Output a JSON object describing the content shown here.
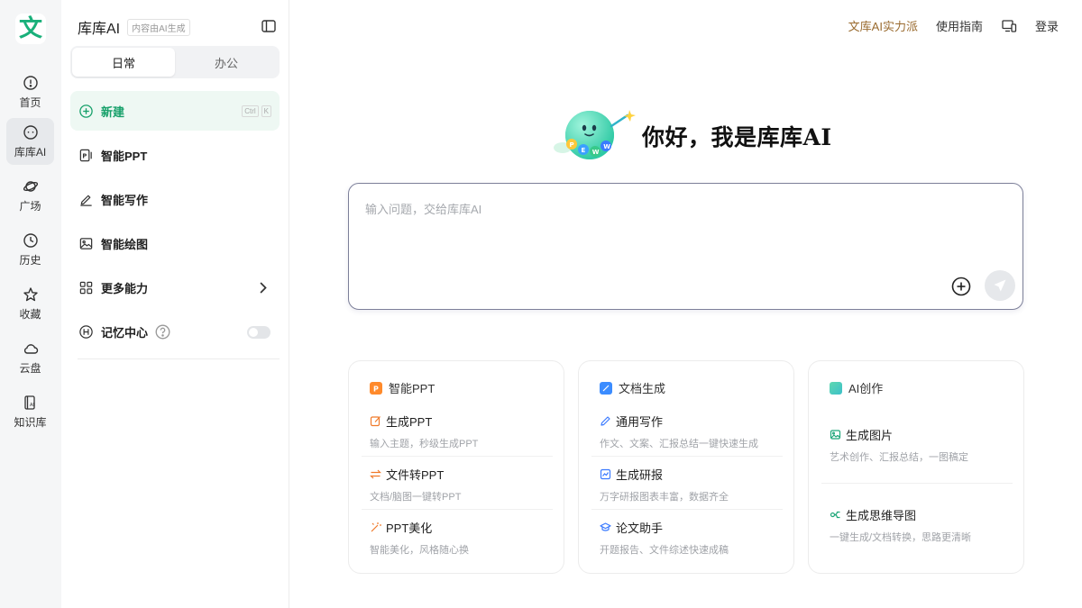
{
  "rail": {
    "logo_char": "文",
    "items": [
      {
        "label": "首页",
        "icon": "home-icon"
      },
      {
        "label": "库库AI",
        "icon": "ai-chat-icon"
      },
      {
        "label": "广场",
        "icon": "planet-icon"
      },
      {
        "label": "历史",
        "icon": "clock-icon"
      },
      {
        "label": "收藏",
        "icon": "star-icon"
      },
      {
        "label": "云盘",
        "icon": "cloud-icon"
      },
      {
        "label": "知识库",
        "icon": "knowledge-base-icon"
      }
    ],
    "active_index": 1
  },
  "panel": {
    "title": "库库AI",
    "badge": "内容由AI生成",
    "tabs": [
      {
        "label": "日常",
        "active": true
      },
      {
        "label": "办公",
        "active": false
      }
    ],
    "nav": [
      {
        "label": "新建",
        "icon": "plus-circle-icon",
        "active": true,
        "shortcut": [
          "Ctrl",
          "K"
        ]
      },
      {
        "label": "智能PPT",
        "icon": "ppt-icon"
      },
      {
        "label": "智能写作",
        "icon": "pen-icon"
      },
      {
        "label": "智能绘图",
        "icon": "image-icon"
      },
      {
        "label": "更多能力",
        "icon": "grid-icon"
      },
      {
        "label": "记忆中心",
        "icon": "memory-icon",
        "toggle_on": false
      }
    ]
  },
  "topbar": {
    "brand_link": "文库AI实力派",
    "guide_link": "使用指南",
    "device_icon": "device-icon",
    "login": "登录"
  },
  "hero": {
    "title": "你好，我是库库AI"
  },
  "input": {
    "placeholder": "输入问题，交给库库AI"
  },
  "colors": {
    "accent_green": "#16a06a",
    "brand_gold": "#9a6b2f",
    "input_border": "#7c7f99"
  },
  "cards": [
    {
      "title": "智能PPT",
      "items": [
        {
          "name": "生成PPT",
          "desc": "输入主题，秒级生成PPT",
          "icon": "edit-square-icon"
        },
        {
          "name": "文件转PPT",
          "desc": "文档/脑图一键转PPT",
          "icon": "swap-icon"
        },
        {
          "name": "PPT美化",
          "desc": "智能美化，风格随心换",
          "icon": "magic-wand-icon"
        }
      ]
    },
    {
      "title": "文档生成",
      "items": [
        {
          "name": "通用写作",
          "desc": "作文、文案、汇报总结一键快速生成",
          "icon": "pencil-icon"
        },
        {
          "name": "生成研报",
          "desc": "万字研报图表丰富，数据齐全",
          "icon": "chart-icon"
        },
        {
          "name": "论文助手",
          "desc": "开题报告、文件综述快速成稿",
          "icon": "graduation-cap-icon"
        }
      ]
    },
    {
      "title": "AI创作",
      "items": [
        {
          "name": "生成图片",
          "desc": "艺术创作、汇报总结，一图稿定",
          "icon": "picture-icon"
        },
        {
          "name": "生成思维导图",
          "desc": "一键生成/文档转换，思路更清晰",
          "icon": "mindmap-icon"
        }
      ]
    }
  ]
}
